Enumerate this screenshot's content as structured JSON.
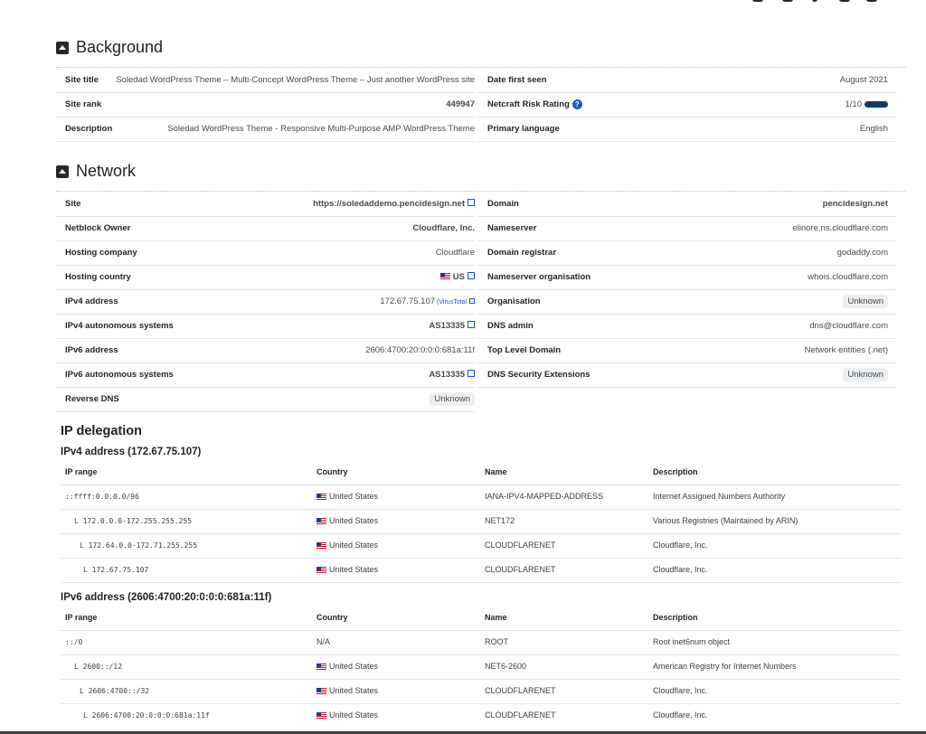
{
  "background": {
    "title": "Background",
    "rows": [
      {
        "k": "Site title",
        "v": "Soledad WordPress Theme – Multi-Concept WordPress Theme – Just another WordPress site"
      },
      {
        "k": "Site rank",
        "v": "449947"
      },
      {
        "k": "Description",
        "v": "Soledad WordPress Theme - Responsive Multi-Purpose AMP WordPress Theme"
      },
      {
        "k": "Date first seen",
        "v": "August 2021"
      },
      {
        "k": "Netcraft Risk Rating",
        "v": "1/10"
      },
      {
        "k": "Primary language",
        "v": "English"
      }
    ]
  },
  "network": {
    "title": "Network",
    "left": [
      {
        "k": "Site",
        "v": "https://soledaddemo.pencidesign.net"
      },
      {
        "k": "Netblock Owner",
        "v": "Cloudflare, Inc."
      },
      {
        "k": "Hosting company",
        "v": "Cloudflare"
      },
      {
        "k": "Hosting country",
        "v": "US"
      },
      {
        "k": "IPv4 address",
        "v": "172.67.75.107",
        "extra": "(VirusTotal"
      },
      {
        "k": "IPv4 autonomous systems",
        "v": "AS13335"
      },
      {
        "k": "IPv6 address",
        "v": "2606:4700:20:0:0:0:681a:11f"
      },
      {
        "k": "IPv6 autonomous systems",
        "v": "AS13335"
      },
      {
        "k": "Reverse DNS",
        "v": "Unknown"
      }
    ],
    "right": [
      {
        "k": "Domain",
        "v": "pencidesign.net"
      },
      {
        "k": "Nameserver",
        "v": "elinore.ns.cloudflare.com"
      },
      {
        "k": "Domain registrar",
        "v": "godaddy.com"
      },
      {
        "k": "Nameserver organisation",
        "v": "whois.cloudflare.com"
      },
      {
        "k": "Organisation",
        "v": "Unknown"
      },
      {
        "k": "DNS admin",
        "v": "dns@cloudflare.com"
      },
      {
        "k": "Top Level Domain",
        "v": "Network entities (.net)"
      },
      {
        "k": "DNS Security Extensions",
        "v": "Unknown"
      }
    ]
  },
  "ip_delegation": {
    "title": "IP delegation",
    "headers": [
      "IP range",
      "Country",
      "Name",
      "Description"
    ],
    "ipv4": {
      "title": "IPv4 address (172.67.75.107)",
      "rows": [
        [
          "::ffff:0.0.0.0/96",
          "United States",
          "IANA-IPV4-MAPPED-ADDRESS",
          "Internet Assigned Numbers Authority"
        ],
        [
          "172.0.0.0-172.255.255.255",
          "United States",
          "NET172",
          "Various Registries (Maintained by ARIN)"
        ],
        [
          "172.64.0.0-172.71.255.255",
          "United States",
          "CLOUDFLARENET",
          "Cloudflare, Inc."
        ],
        [
          "172.67.75.107",
          "United States",
          "CLOUDFLARENET",
          "Cloudflare, Inc."
        ]
      ]
    },
    "ipv6": {
      "title": "IPv6 address (2606:4700:20:0:0:0:681a:11f)",
      "rows": [
        [
          "::/0",
          "N/A",
          "ROOT",
          "Root inet6num object"
        ],
        [
          "2600::/12",
          "United States",
          "NET6-2600",
          "American Registry for Internet Numbers"
        ],
        [
          "2606:4700::/32",
          "United States",
          "CLOUDFLARENET",
          "Cloudflare, Inc."
        ],
        [
          "2606:4700:20:0:0:0:681a:11f",
          "United States",
          "CLOUDFLARENET",
          "Cloudflare, Inc."
        ]
      ]
    },
    "branch_glyph": "L"
  }
}
